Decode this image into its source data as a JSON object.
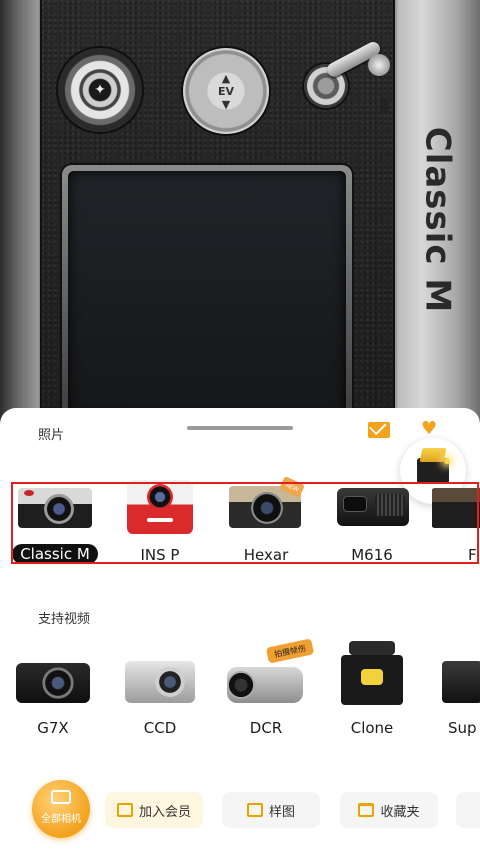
{
  "camera": {
    "brand_text": "Classic M",
    "ev_label": "EV"
  },
  "sheet": {
    "photo_title": "照片",
    "video_title": "支持视频",
    "photo_cameras": [
      {
        "label": "Classic M",
        "selected": true
      },
      {
        "label": "INS P",
        "selected": false
      },
      {
        "label": "Hexar",
        "selected": false
      },
      {
        "label": "M616",
        "selected": false
      },
      {
        "label": "F",
        "selected": false
      }
    ],
    "video_cameras": [
      {
        "label": "G7X"
      },
      {
        "label": "CCD"
      },
      {
        "label": "DCR"
      },
      {
        "label": "Clone"
      },
      {
        "label": "Sup"
      }
    ],
    "new_badge": "NEW",
    "dcr_tag": "拍摄帧伤"
  },
  "toolbar": {
    "all_cameras": "全部相机",
    "member": "加入会员",
    "sample": "样图",
    "favorites": "收藏夹"
  },
  "colors": {
    "accent": "#f2a21c",
    "selection": "#e02020"
  }
}
